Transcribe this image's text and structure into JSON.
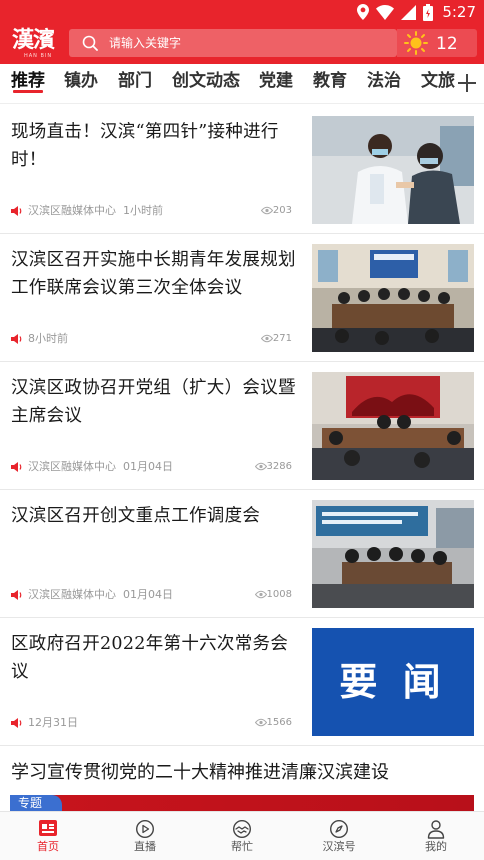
{
  "status_bar": {
    "time": "5:27"
  },
  "header": {
    "logo_text": "漢濱",
    "logo_sub": "HAN BIN",
    "search_placeholder": "请输入关键字",
    "weather_temp": "12"
  },
  "tabs": [
    {
      "label": "推荐",
      "active": true
    },
    {
      "label": "镇办"
    },
    {
      "label": "部门"
    },
    {
      "label": "创文动态"
    },
    {
      "label": "党建"
    },
    {
      "label": "教育"
    },
    {
      "label": "法治"
    },
    {
      "label": "文旅"
    }
  ],
  "news": [
    {
      "title": "现场直击！汉滨“第四针”接种进行时！",
      "source": "汉滨区融媒体中心",
      "time": "1小时前",
      "views": "203",
      "thumb": "vaccination-photo"
    },
    {
      "title": "汉滨区召开实施中长期青年发展规划工作联席会议第三次全体会议",
      "source": "",
      "time": "8小时前",
      "views": "271",
      "thumb": "meeting-room-photo"
    },
    {
      "title": "汉滨区政协召开党组（扩大）会议暨主席会议",
      "source": "汉滨区融媒体中心",
      "time": "01月04日",
      "views": "3286",
      "thumb": "cppcc-meeting-photo"
    },
    {
      "title": "汉滨区召开创文重点工作调度会",
      "source": "汉滨区融媒体中心",
      "time": "01月04日",
      "views": "1008",
      "thumb": "work-meeting-photo"
    },
    {
      "title": "区政府召开2022年第十六次常务会议",
      "source": "",
      "time": "12月31日",
      "views": "1566",
      "thumb": "important-news-banner",
      "thumb_text": "要 闻"
    }
  ],
  "headline": "学习宣传贯彻党的二十大精神推进清廉汉滨建设",
  "special_tag": "专题",
  "bottom_nav": [
    {
      "label": "首页",
      "icon": "home-icon",
      "active": true
    },
    {
      "label": "直播",
      "icon": "live-play-icon"
    },
    {
      "label": "帮忙",
      "icon": "help-handshake-icon"
    },
    {
      "label": "汉滨号",
      "icon": "compass-icon"
    },
    {
      "label": "我的",
      "icon": "profile-icon"
    }
  ],
  "colors": {
    "brand_red": "#e8242c",
    "nav_blue": "#1552b0"
  }
}
